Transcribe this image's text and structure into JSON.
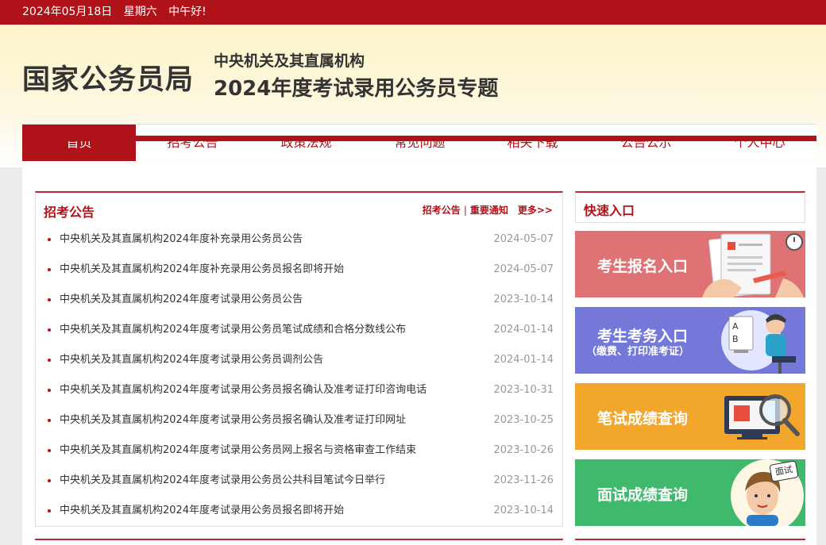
{
  "topbar": {
    "date": "2024年05月18日",
    "weekday": "星期六",
    "greeting": "中午好!"
  },
  "header": {
    "logo": "国家公务员局",
    "subtitle1": "中央机关及其直属机构",
    "subtitle2": "2024年度考试录用公务员专题"
  },
  "nav": {
    "items": [
      {
        "label": "首页"
      },
      {
        "label": "招考公告"
      },
      {
        "label": "政策法规"
      },
      {
        "label": "常见问题"
      },
      {
        "label": "相关下载"
      },
      {
        "label": "公告公示"
      },
      {
        "label": "个人中心"
      }
    ]
  },
  "announcements": {
    "title": "招考公告",
    "link1": "招考公告",
    "divider": "|",
    "link2": "重要通知",
    "more": "更多>>",
    "items": [
      {
        "title": "中央机关及其直属机构2024年度补充录用公务员公告",
        "date": "2024-05-07"
      },
      {
        "title": "中央机关及其直属机构2024年度补充录用公务员报名即将开始",
        "date": "2024-05-07"
      },
      {
        "title": "中央机关及其直属机构2024年度考试录用公务员公告",
        "date": "2023-10-14"
      },
      {
        "title": "中央机关及其直属机构2024年度考试录用公务员笔试成绩和合格分数线公布",
        "date": "2024-01-14"
      },
      {
        "title": "中央机关及其直属机构2024年度考试录用公务员调剂公告",
        "date": "2024-01-14"
      },
      {
        "title": "中央机关及其直属机构2024年度考试录用公务员报名确认及准考证打印咨询电话",
        "date": "2023-10-31"
      },
      {
        "title": "中央机关及其直属机构2024年度考试录用公务员报名确认及准考证打印网址",
        "date": "2023-10-25"
      },
      {
        "title": "中央机关及其直属机构2024年度考试录用公务员网上报名与资格审查工作结束",
        "date": "2023-10-26"
      },
      {
        "title": "中央机关及其直属机构2024年度考试录用公务员公共科目笔试今日举行",
        "date": "2023-11-26"
      },
      {
        "title": "中央机关及其直属机构2024年度考试录用公务员报名即将开始",
        "date": "2023-10-14"
      }
    ]
  },
  "quick": {
    "title": "快速入口",
    "entries": [
      {
        "label": "考生报名入口"
      },
      {
        "label": "考生考务入口",
        "sublabel": "（缴费、打印准考证）"
      },
      {
        "label": "笔试成绩查询"
      },
      {
        "label": "面试成绩查询",
        "badge": "面试"
      }
    ]
  },
  "colors": {
    "brand": "#b0121a",
    "entry1": "#df7275",
    "entry2": "#7478d8",
    "entry3": "#f2a62c",
    "entry4": "#3fba6c"
  }
}
